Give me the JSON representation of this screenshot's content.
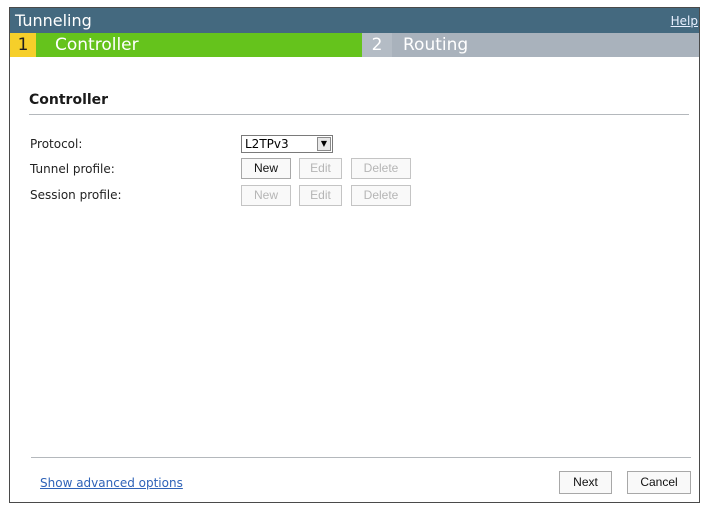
{
  "dialog": {
    "title": "Tunneling",
    "help_label": "Help"
  },
  "steps": [
    {
      "number": "1",
      "label": "Controller",
      "active": true,
      "color": "#65c31c"
    },
    {
      "number": "2",
      "label": "Routing",
      "active": false,
      "color": "#a9b2bc"
    }
  ],
  "section": {
    "title": "Controller"
  },
  "form": {
    "protocol_label": "Protocol:",
    "protocol_value": "L2TPv3",
    "tunnel_profile_label": "Tunnel profile:",
    "session_profile_label": "Session profile:",
    "new_label": "New",
    "edit_label": "Edit",
    "delete_label": "Delete"
  },
  "footer": {
    "advanced_label": "Show advanced options",
    "next_label": "Next",
    "cancel_label": "Cancel"
  },
  "colors": {
    "titlebar": "#44697f",
    "step_number_active": "#f6cf2a",
    "link": "#2f63b8"
  }
}
